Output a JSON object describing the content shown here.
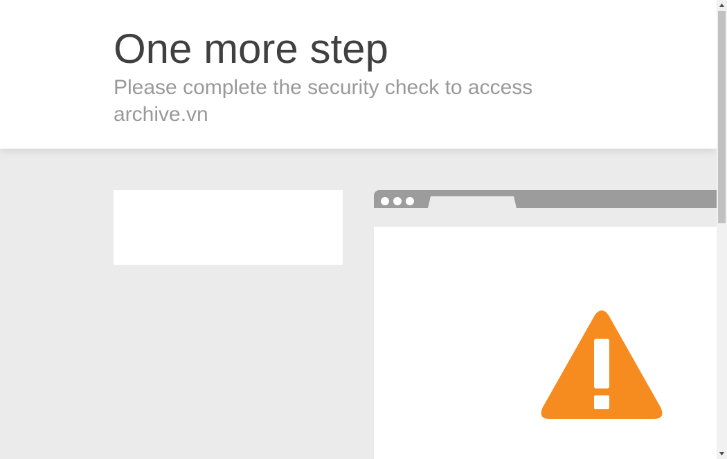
{
  "header": {
    "title": "One more step",
    "subtitle": "Please complete the security check to access archive.vn"
  },
  "security_check": {
    "state": "empty"
  },
  "illustration": {
    "icon": "warning-icon",
    "warning_color": "#f68b1f"
  },
  "colors": {
    "title": "#404040",
    "subtitle": "#999999",
    "page_background": "#ebebeb",
    "browser_bar": "#9c9c9c"
  }
}
